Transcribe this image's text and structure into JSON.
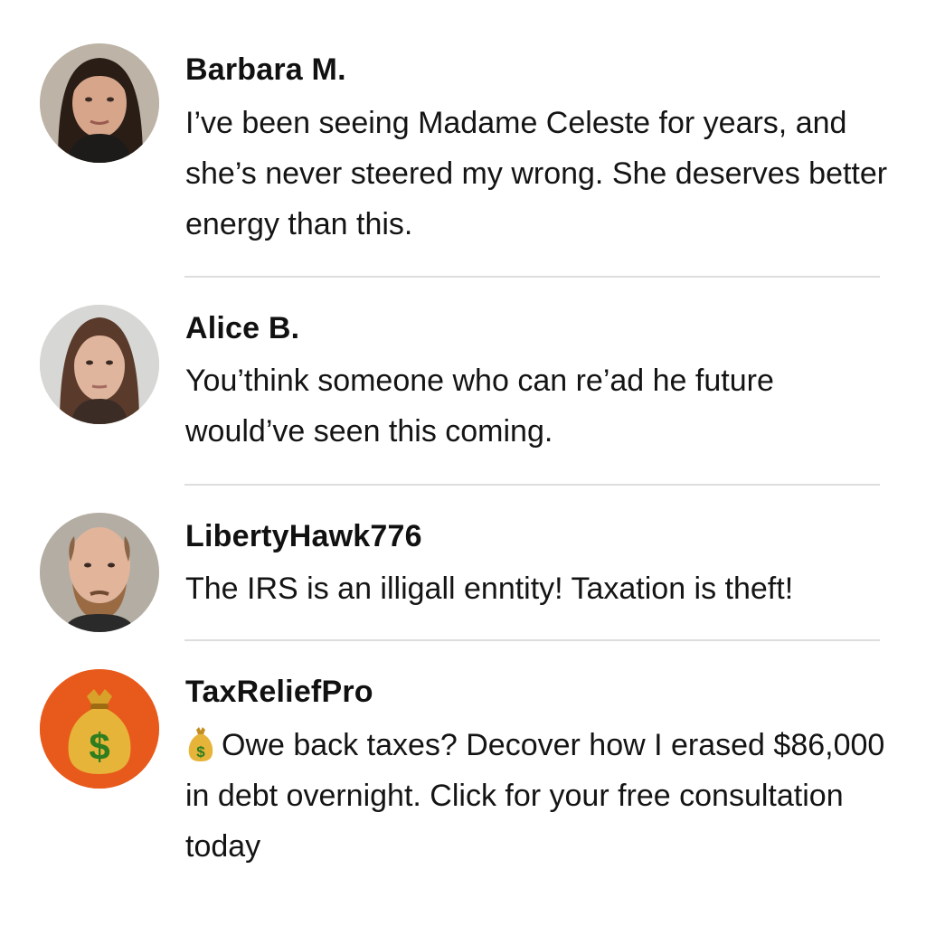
{
  "comments": [
    {
      "author": "Barbara M.",
      "text": "I’ve been seeing Madame Celeste for years, and she’s never steered my wrong. She deserves better energy than this.",
      "avatar_icon": "person-photo"
    },
    {
      "author": "Alice B.",
      "text": "You’think someone who can re’ad he future would’ve seen this coming.",
      "avatar_icon": "person-photo"
    },
    {
      "author": "LibertyHawk776",
      "text": "The IRS is an illigall enntity! Taxation is theft!",
      "avatar_icon": "person-photo"
    },
    {
      "author": "TaxReliefPro",
      "text": "Owe back taxes? Decover how I erased $86,000 in debt overnight. Click for your free consultation today",
      "avatar_icon": "money-bag-icon",
      "emoji": "money-bag-emoji",
      "avatar_bg": "#e85a1b"
    }
  ]
}
